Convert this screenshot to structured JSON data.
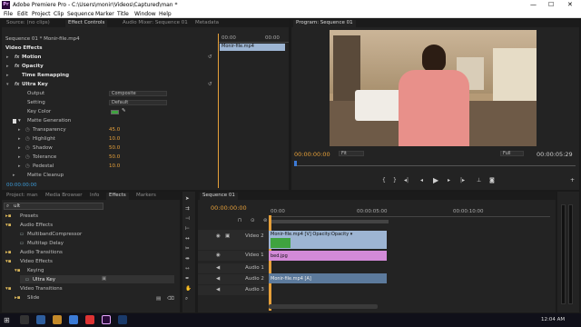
{
  "window": {
    "title": "Adobe Premiere Pro - C:\\Users\\monir\\Videos\\Captured\\man *",
    "app_icon": "Pr",
    "minimize": "—",
    "maximize": "☐",
    "close": "✕"
  },
  "menu": [
    "File",
    "Edit",
    "Project",
    "Clip",
    "Sequence",
    "Marker",
    "Title",
    "Window",
    "Help"
  ],
  "source_panel": {
    "tabs": [
      "Source: (no clips)",
      "Effect Controls",
      "Audio Mixer: Sequence 01",
      "Metadata"
    ],
    "breadcrumb": "Sequence 01 * Monir-file.mp4",
    "section": "Video Effects",
    "mini_clip": "Monir-file.mp4",
    "ruler": [
      "00:00",
      "00:00"
    ],
    "effects": [
      {
        "name": "Motion",
        "fx": "fx"
      },
      {
        "name": "Opacity",
        "fx": "fx"
      },
      {
        "name": "Time Remapping",
        "fx": ""
      },
      {
        "name": "Ultra Key",
        "fx": "fx"
      }
    ],
    "output_label": "Output",
    "output_value": "Composite",
    "setting_label": "Setting",
    "setting_value": "Default",
    "keycolor_label": "Key Color",
    "key_color": "#3fa33f",
    "matte_generation": "Matte Generation",
    "params": [
      {
        "label": "Transparency",
        "value": "45.0"
      },
      {
        "label": "Highlight",
        "value": "10.0"
      },
      {
        "label": "Shadow",
        "value": "50.0"
      },
      {
        "label": "Tolerance",
        "value": "50.0"
      },
      {
        "label": "Pedestal",
        "value": "10.0"
      }
    ],
    "matte_cleanup": "Matte Cleanup",
    "timecode": "00:00:00:00"
  },
  "program": {
    "tab": "Program: Sequence 01",
    "timecode": "00:00:00:00",
    "fit": "Fit",
    "quality": "Full",
    "duration": "00:00:05:29"
  },
  "project": {
    "tabs": [
      "Project: man",
      "Media Browser",
      "Info",
      "Effects",
      "Markers"
    ],
    "search": "ult",
    "tree": [
      {
        "label": "Presets",
        "level": 0,
        "type": "folder"
      },
      {
        "label": "Audio Effects",
        "level": 0,
        "type": "folder"
      },
      {
        "label": "MultibandCompressor",
        "level": 1,
        "type": "fx"
      },
      {
        "label": "Multitap Delay",
        "level": 1,
        "type": "fx"
      },
      {
        "label": "Audio Transitions",
        "level": 0,
        "type": "folder"
      },
      {
        "label": "Video Effects",
        "level": 0,
        "type": "folder"
      },
      {
        "label": "Keying",
        "level": 1,
        "type": "folder"
      },
      {
        "label": "Ultra Key",
        "level": 2,
        "type": "fx"
      },
      {
        "label": "Video Transitions",
        "level": 0,
        "type": "folder"
      },
      {
        "label": "Slide",
        "level": 1,
        "type": "folder"
      }
    ]
  },
  "timeline": {
    "tab": "Sequence 01",
    "timecode": "00:00:00:00",
    "ruler": [
      "00:00",
      "00:00:05:00",
      "00:00:10:00"
    ],
    "tracks": [
      {
        "name": "Video 2",
        "clip": "Monir-file.mp4 [V]  Opacity:Opacity ▾"
      },
      {
        "name": "Video 1",
        "clip": "bed.jpg"
      },
      {
        "name": "Audio 1",
        "clip": "Monir-file.mp4 [A]"
      },
      {
        "name": "Audio 2",
        "clip": ""
      },
      {
        "name": "Audio 3",
        "clip": ""
      }
    ]
  },
  "taskbar": {
    "time": "12:04 AM"
  },
  "colors": {
    "accent": "#e6a03a",
    "video_clip": "#9db5d3",
    "image_clip": "#d38ad8",
    "audio_clip": "#5c7a9c"
  }
}
